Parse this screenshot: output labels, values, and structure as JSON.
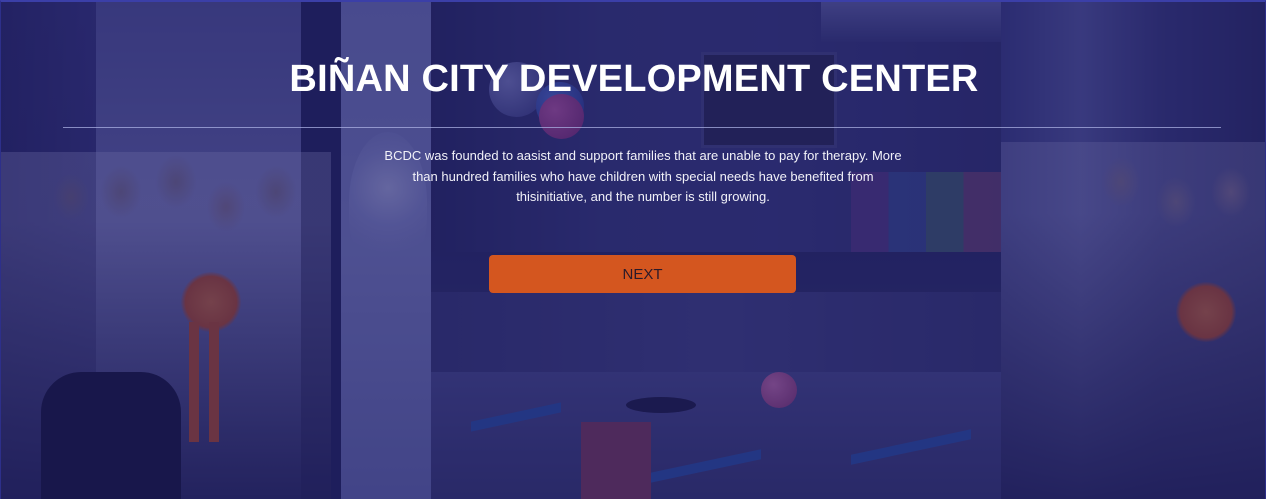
{
  "hero": {
    "title": "BIÑAN CITY DEVELOPMENT CENTER",
    "description": "BCDC was founded to aasist and support families that are unable to pay for therapy. More than hundred families who have children with special needs have benefited from thisinitiative, and the number is still growing.",
    "next_label": "NEXT"
  },
  "colors": {
    "overlay": "#1c1a64",
    "button": "#d4561f",
    "title_text": "#ffffff"
  }
}
